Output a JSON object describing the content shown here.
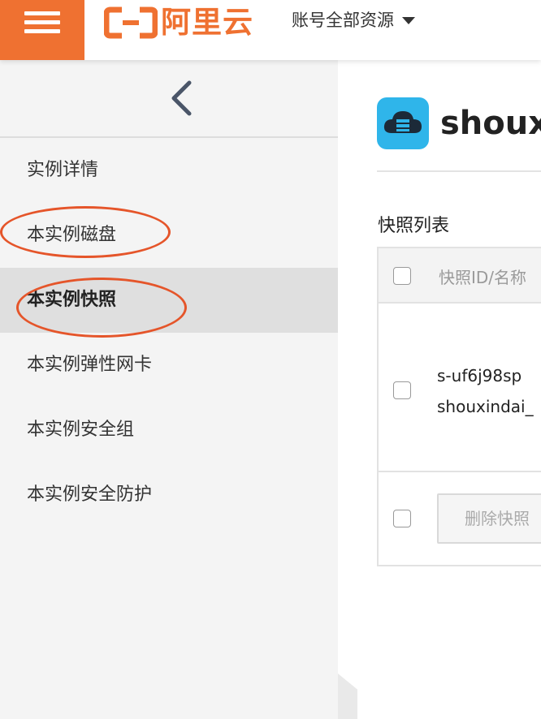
{
  "header": {
    "logo_text": "阿里云",
    "account_scope": "账号全部资源",
    "brand_color": "#ef7131"
  },
  "sidebar": {
    "back_icon": "chevron-left-icon",
    "items": [
      {
        "label": "实例详情",
        "active": false
      },
      {
        "label": "本实例磁盘",
        "active": false,
        "annotated": true
      },
      {
        "label": "本实例快照",
        "active": true,
        "annotated": true
      },
      {
        "label": "本实例弹性网卡",
        "active": false
      },
      {
        "label": "本实例安全组",
        "active": false
      },
      {
        "label": "本实例安全防护",
        "active": false
      }
    ],
    "annotation_color": "#e5552a"
  },
  "main": {
    "instance_icon": "cloud-server-icon",
    "instance_name": "shoux",
    "section_title": "快照列表",
    "table": {
      "header": "快照ID/名称",
      "rows": [
        {
          "id": "s-uf6j98sp",
          "name": "shouxindai_"
        }
      ],
      "delete_button": "删除快照"
    }
  }
}
